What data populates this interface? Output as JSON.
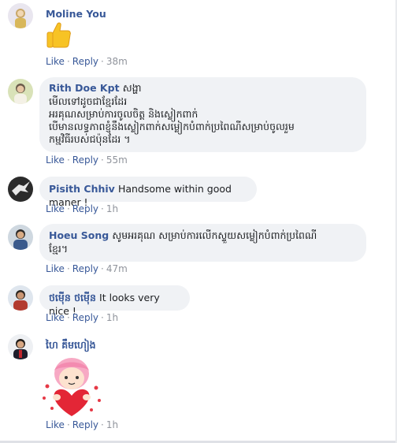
{
  "actions": {
    "like": "Like",
    "reply": "Reply",
    "separator": "·"
  },
  "comments": [
    {
      "author": "Moline You",
      "text": "",
      "reaction": "thumbs-up-emoji",
      "time": "38m"
    },
    {
      "author": "Rith Doe Kpt",
      "suffix": "សង្ហា",
      "lines": [
        "មើលទៅដូចជាខ្មែរដែរ",
        "អរគុណសម្រាប់ការចូលចិត្ត និងស្លៀកពាក់",
        "បើមានលទ្ធភាពខ្ញុំនឹងស្លៀកពាក់សម្លៀកបំពាក់ប្រពៃណីសម្រាប់ចូលរួម",
        "កម្មវិធីរបស់ជប៉ុនដែរ ។"
      ],
      "time": "55m"
    },
    {
      "author": "Pisith Chhiv",
      "text": "Handsome within good maner !",
      "time": "1h"
    },
    {
      "author": "Hoeu Song",
      "text": "សូមអរគុណ សម្រាប់ការលើកស្ទួយសម្លៀកបំពាក់ប្រពៃណី",
      "text2": "ខ្មែរ។",
      "time": "47m"
    },
    {
      "author": "ថម៉ើន ថម៉ើន",
      "text": "It looks very nice !",
      "time": "1h"
    },
    {
      "author": "ហៃ គឹមហៀង",
      "sticker": "girl-heart-sticker",
      "time": "1h"
    }
  ]
}
